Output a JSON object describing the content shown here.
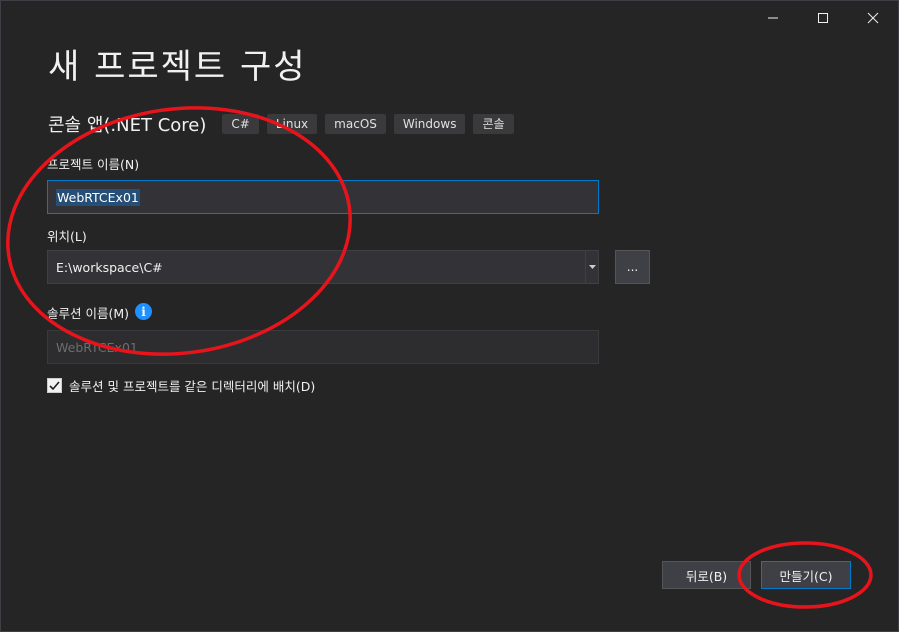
{
  "title": "새 프로젝트 구성",
  "template": {
    "name": "콘솔 앱(.NET Core)",
    "tags": [
      "C#",
      "Linux",
      "macOS",
      "Windows",
      "콘솔"
    ]
  },
  "project_name": {
    "label": "프로젝트 이름(N)",
    "value": "WebRTCEx01"
  },
  "location": {
    "label": "위치(L)",
    "value": "E:\\workspace\\C#",
    "browse_label": "..."
  },
  "solution_name": {
    "label": "솔루션 이름(M)",
    "value": "WebRTCEx01",
    "info_icon": "info-icon"
  },
  "same_directory": {
    "label": "솔루션 및 프로젝트를 같은 디렉터리에 배치(D)",
    "checked": true
  },
  "footer": {
    "back_label": "뒤로(B)",
    "create_label": "만들기(C)"
  },
  "colors": {
    "background": "#252526",
    "accent": "#007acc",
    "annotation": "#e8141c",
    "info": "#1e90ff"
  }
}
